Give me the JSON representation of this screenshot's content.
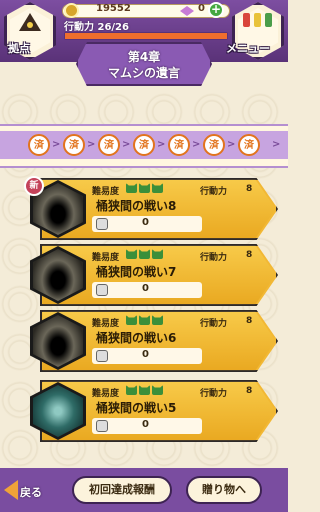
{
  "header": {
    "base_label": "拠点",
    "menu_label": "メニュー",
    "money": "19552",
    "gems": "0",
    "plus": "+",
    "stamina_label": "行動力",
    "stamina_value": "26/26",
    "stamina_fraction": 1.0
  },
  "chapter": {
    "number": "第4章",
    "title": "マムシの遺言"
  },
  "progress": {
    "badges": [
      "済",
      "済",
      "済",
      "済",
      "済",
      "済",
      "済"
    ],
    "arrow": ">"
  },
  "stages": [
    {
      "name": "桶狭間の戦い8",
      "difficulty_label": "難易度",
      "ap_label": "行動力",
      "ap": "8",
      "reward": "0",
      "is_new": true,
      "new_label": "新",
      "thumb": "cave"
    },
    {
      "name": "桶狭間の戦い7",
      "difficulty_label": "難易度",
      "ap_label": "行動力",
      "ap": "8",
      "reward": "0",
      "is_new": false,
      "thumb": "cave"
    },
    {
      "name": "桶狭間の戦い6",
      "difficulty_label": "難易度",
      "ap_label": "行動力",
      "ap": "8",
      "reward": "0",
      "is_new": false,
      "thumb": "cave"
    },
    {
      "name": "桶狭間の戦い5",
      "difficulty_label": "難易度",
      "ap_label": "行動力",
      "ap": "8",
      "reward": "0",
      "is_new": false,
      "thumb": "forest"
    }
  ],
  "footer": {
    "back_label": "戻る",
    "first_reward_label": "初回達成報酬",
    "gift_label": "贈り物へ"
  },
  "colors": {
    "header_purple": "#6b3f8e",
    "card_gold": "#f2b834",
    "stamina_orange": "#ef6e2d",
    "difficulty_green": "#3b8f3a"
  }
}
